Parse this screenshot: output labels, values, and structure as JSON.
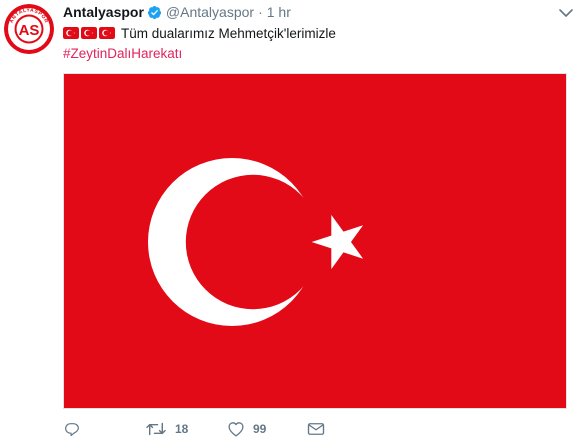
{
  "account": {
    "name": "Antalyaspor",
    "handle": "@Antalyaspor",
    "separator": "·",
    "time": "1 hr",
    "avatar_icon": "antalyaspor-logo"
  },
  "tweet": {
    "flags_icon": "turkish-flag-emoji",
    "flags_count": 3,
    "text": "Tüm dualarımız Mehmetçik'lerimizle",
    "hashtag": "#ZeytinDalıHarekatı"
  },
  "media": {
    "description_icon": "turkish-flag-image",
    "colors": {
      "red": "#e30a17",
      "white": "#ffffff"
    }
  },
  "actions": {
    "reply_icon": "reply-icon",
    "retweet_icon": "retweet-icon",
    "retweet_count": "18",
    "like_icon": "heart-icon",
    "like_count": "99",
    "dm_icon": "envelope-icon"
  },
  "colors": {
    "text": "#14171a",
    "muted": "#657786",
    "hashtag": "#e0245e",
    "verified": "#1da1f2"
  }
}
